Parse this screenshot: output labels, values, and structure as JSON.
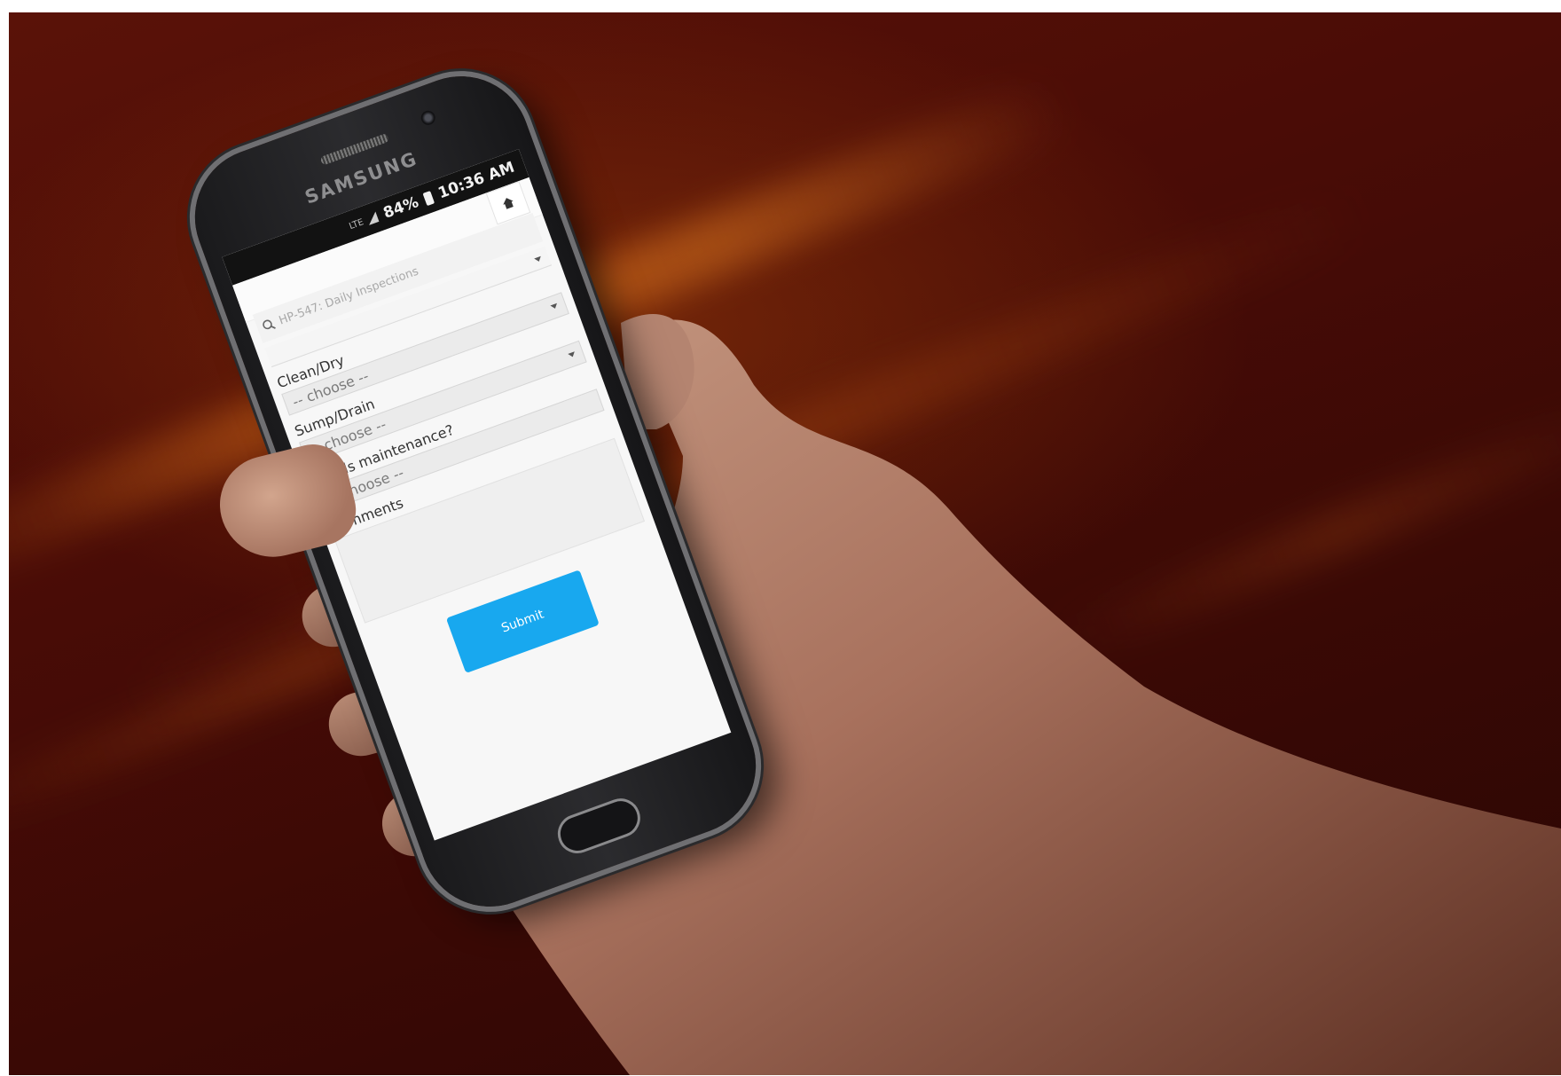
{
  "device": {
    "brand": "SAMSUNG"
  },
  "status_bar": {
    "network": "LTE",
    "battery_percent": "84%",
    "time": "10:36 AM"
  },
  "search": {
    "value": "HP-547: Daily Inspections"
  },
  "form": {
    "fields": [
      {
        "label": "Clean/Dry",
        "value": "-- choose --"
      },
      {
        "label": "Sump/Drain",
        "value": "-- choose --"
      },
      {
        "label": "Needs maintenance?",
        "value": "-- choose --"
      }
    ],
    "comments_label": "Comments",
    "submit_label": "Submit"
  },
  "colors": {
    "submit_button": "#18a8ef",
    "background": "#4a0c06"
  },
  "icons": {
    "home": "home-icon",
    "search": "search-icon",
    "dropdown": "chevron-down-icon"
  }
}
